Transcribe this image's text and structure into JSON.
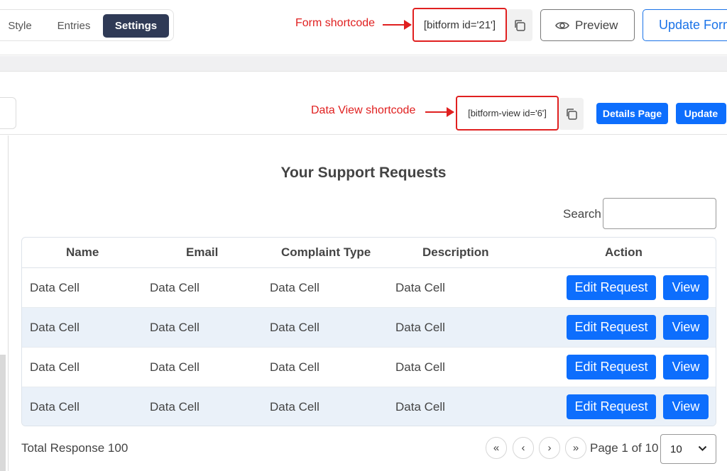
{
  "tabs": [
    {
      "label": "Style"
    },
    {
      "label": "Entries"
    },
    {
      "label": "Settings",
      "active": true
    }
  ],
  "annotations": {
    "form_shortcode": "Form shortcode",
    "data_view_shortcode": "Data View shortcode",
    "color": "#e02020"
  },
  "form_shortcode": "[bitform id='21']",
  "toolbar": {
    "preview_label": "Preview",
    "update_form_label": "Update Form"
  },
  "data_view": {
    "shortcode": "[bitform-view id='6']",
    "details_page_label": "Details Page",
    "update_label": "Update"
  },
  "main": {
    "title": "Your Support Requests",
    "search_label": "Search",
    "search_value": ""
  },
  "table": {
    "columns": [
      "Name",
      "Email",
      "Complaint Type",
      "Description",
      "Action"
    ],
    "rows": [
      [
        "Data Cell",
        "Data Cell",
        "Data Cell",
        "Data Cell"
      ],
      [
        "Data Cell",
        "Data Cell",
        "Data Cell",
        "Data Cell"
      ],
      [
        "Data Cell",
        "Data Cell",
        "Data Cell",
        "Data Cell"
      ],
      [
        "Data Cell",
        "Data Cell",
        "Data Cell",
        "Data Cell"
      ]
    ],
    "edit_label": "Edit Request",
    "view_label": "View"
  },
  "footer": {
    "total": "Total Response 100",
    "first": "«",
    "prev": "‹",
    "next": "›",
    "last": "»",
    "page_info": "Page 1 of 10",
    "page_size": "10"
  },
  "colors": {
    "accent_blue": "#0d6efd",
    "active_tab": "#2f3a56",
    "row_alt": "#eaf1f9"
  },
  "icons": {
    "copy": "copy-icon",
    "preview": "eye-icon",
    "dropdown": "chevron-down-icon"
  }
}
